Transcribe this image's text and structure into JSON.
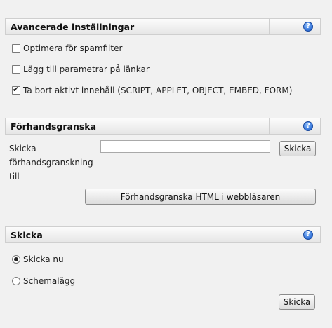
{
  "advanced": {
    "header": "Avancerade inställningar",
    "help_glyph": "?",
    "options": [
      {
        "label": "Optimera för spamfilter",
        "checked": false
      },
      {
        "label": "Lägg till parametrar på länkar",
        "checked": false
      },
      {
        "label": "Ta bort aktivt innehåll (SCRIPT, APPLET, OBJECT, EMBED, FORM)",
        "checked": true
      }
    ]
  },
  "preview": {
    "header": "Förhandsgranska",
    "help_glyph": "?",
    "send_to_label_lines": [
      "Skicka",
      "förhandsgranskning",
      "till"
    ],
    "email_value": "",
    "send_button": "Skicka",
    "browser_preview_button": "Förhandsgranska HTML i webbläsaren"
  },
  "send": {
    "header": "Skicka",
    "help_glyph": "?",
    "options": [
      {
        "label": "Skicka nu",
        "selected": true
      },
      {
        "label": "Schemalägg",
        "selected": false
      }
    ],
    "submit_button": "Skicka"
  },
  "icons": {
    "help": "help-question-icon"
  }
}
